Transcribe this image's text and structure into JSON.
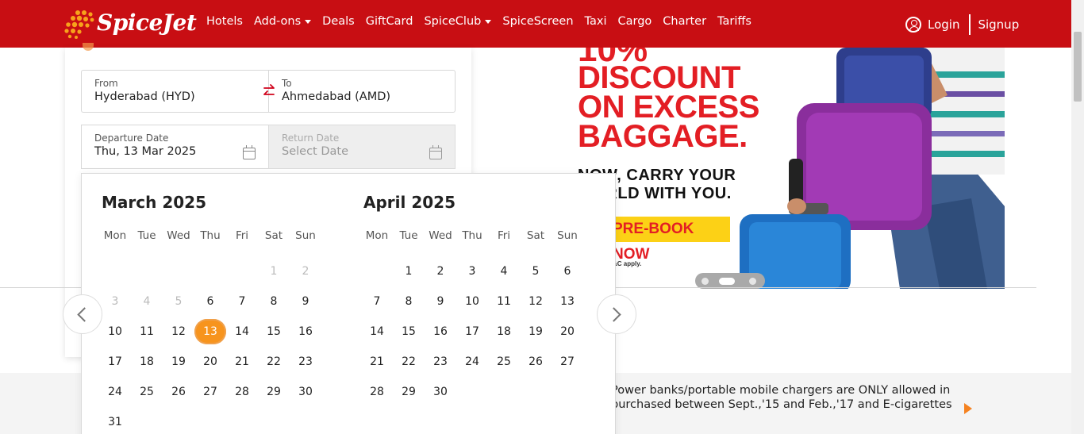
{
  "header": {
    "brand": "SpiceJet",
    "nav": [
      {
        "label": "Hotels",
        "dropdown": false
      },
      {
        "label": "Add-ons",
        "dropdown": true
      },
      {
        "label": "Deals",
        "dropdown": false
      },
      {
        "label": "GiftCard",
        "dropdown": false
      },
      {
        "label": "SpiceClub",
        "dropdown": true
      },
      {
        "label": "SpiceScreen",
        "dropdown": false
      },
      {
        "label": "Taxi",
        "dropdown": false
      },
      {
        "label": "Cargo",
        "dropdown": false
      },
      {
        "label": "Charter",
        "dropdown": false
      },
      {
        "label": "Tariffs",
        "dropdown": false
      }
    ],
    "login": "Login",
    "signup": "Signup"
  },
  "search": {
    "from_label": "From",
    "from_value": "Hyderabad (HYD)",
    "to_label": "To",
    "to_value": "Ahmedabad (AMD)",
    "departure_label": "Departure Date",
    "departure_value": "Thu, 13 Mar 2025",
    "return_label": "Return Date",
    "return_placeholder": "Select Date"
  },
  "calendar": {
    "weekdays": [
      "Mon",
      "Tue",
      "Wed",
      "Thu",
      "Fri",
      "Sat",
      "Sun"
    ],
    "months": [
      {
        "title": "March 2025",
        "offset": 5,
        "days": 31,
        "disabled_until": 5,
        "selected": 13
      },
      {
        "title": "April 2025",
        "offset": 1,
        "days": 30,
        "disabled_until": 0,
        "selected": null
      }
    ]
  },
  "banner": {
    "top_cut": "10%",
    "headline": [
      "DISCOUNT",
      "ON EXCESS",
      "BAGGAGE."
    ],
    "subline": [
      "NOW, CARRY YOUR",
      "WORLD WITH YOU."
    ],
    "cta": "PRE-BOOK NOW",
    "fine_print": "*T&C apply."
  },
  "notice": {
    "line1": "Power banks/portable mobile chargers are ONLY allowed in",
    "line2": "purchased between Sept.,'15 and Feb.,'17 and E-cigarettes"
  },
  "colors": {
    "brand_red": "#c80e13",
    "accent_orange": "#f7941d",
    "banner_red": "#e31e24",
    "banner_yellow": "#fcd116"
  }
}
